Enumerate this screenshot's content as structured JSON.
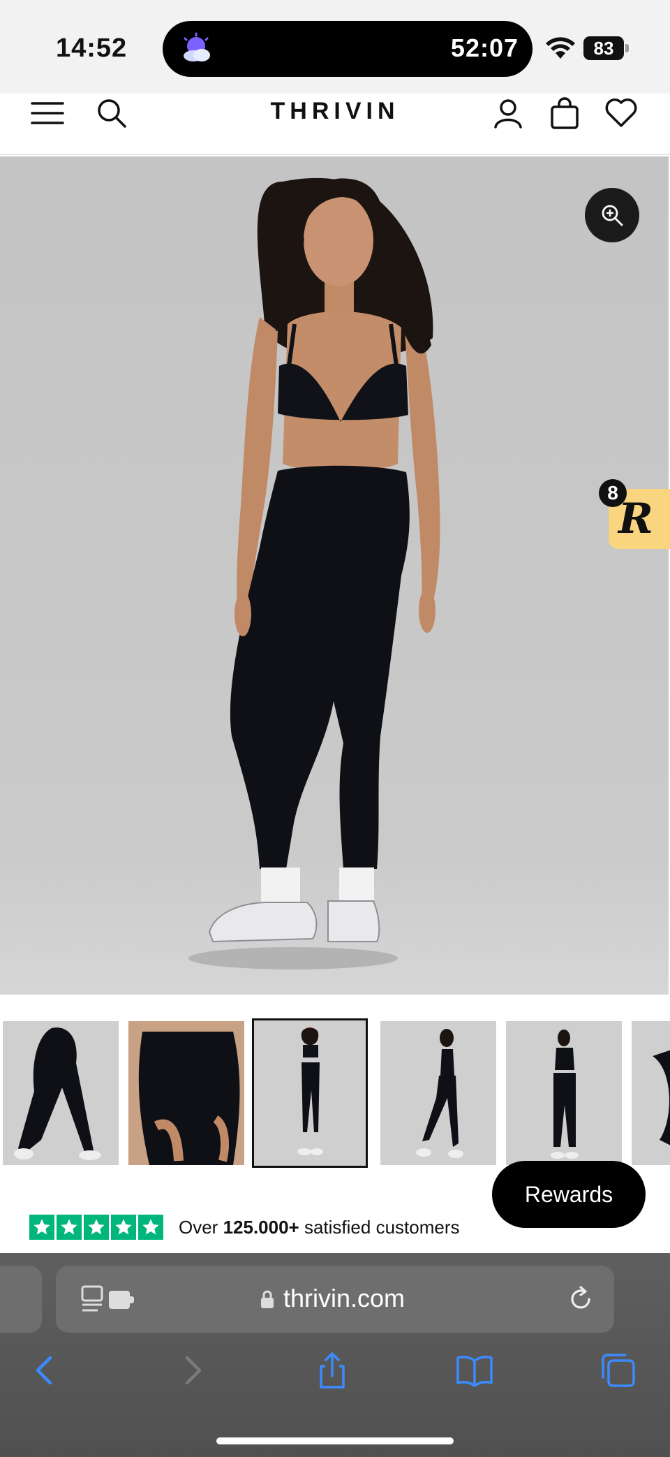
{
  "status_bar": {
    "time": "14:52",
    "activity_timer": "52:07",
    "battery": "83"
  },
  "header": {
    "logo": "THRIVIN"
  },
  "hero": {
    "zoom_icon": "zoom-in-icon"
  },
  "rewards_widget": {
    "badge_count": "8",
    "glyph": "R",
    "button_label": "Rewards"
  },
  "thumbnails": {
    "count_visible": 6,
    "active_index": 2
  },
  "trust": {
    "stars": 5,
    "prefix": "Over ",
    "count": "125.000+",
    "suffix": " satisfied customers",
    "star_color": "#00b67a"
  },
  "browser": {
    "url": "thrivin.com"
  },
  "colors": {
    "accent": "#000000",
    "rewards_tab": "#f8d57e",
    "safari_blue": "#3b8bff"
  }
}
